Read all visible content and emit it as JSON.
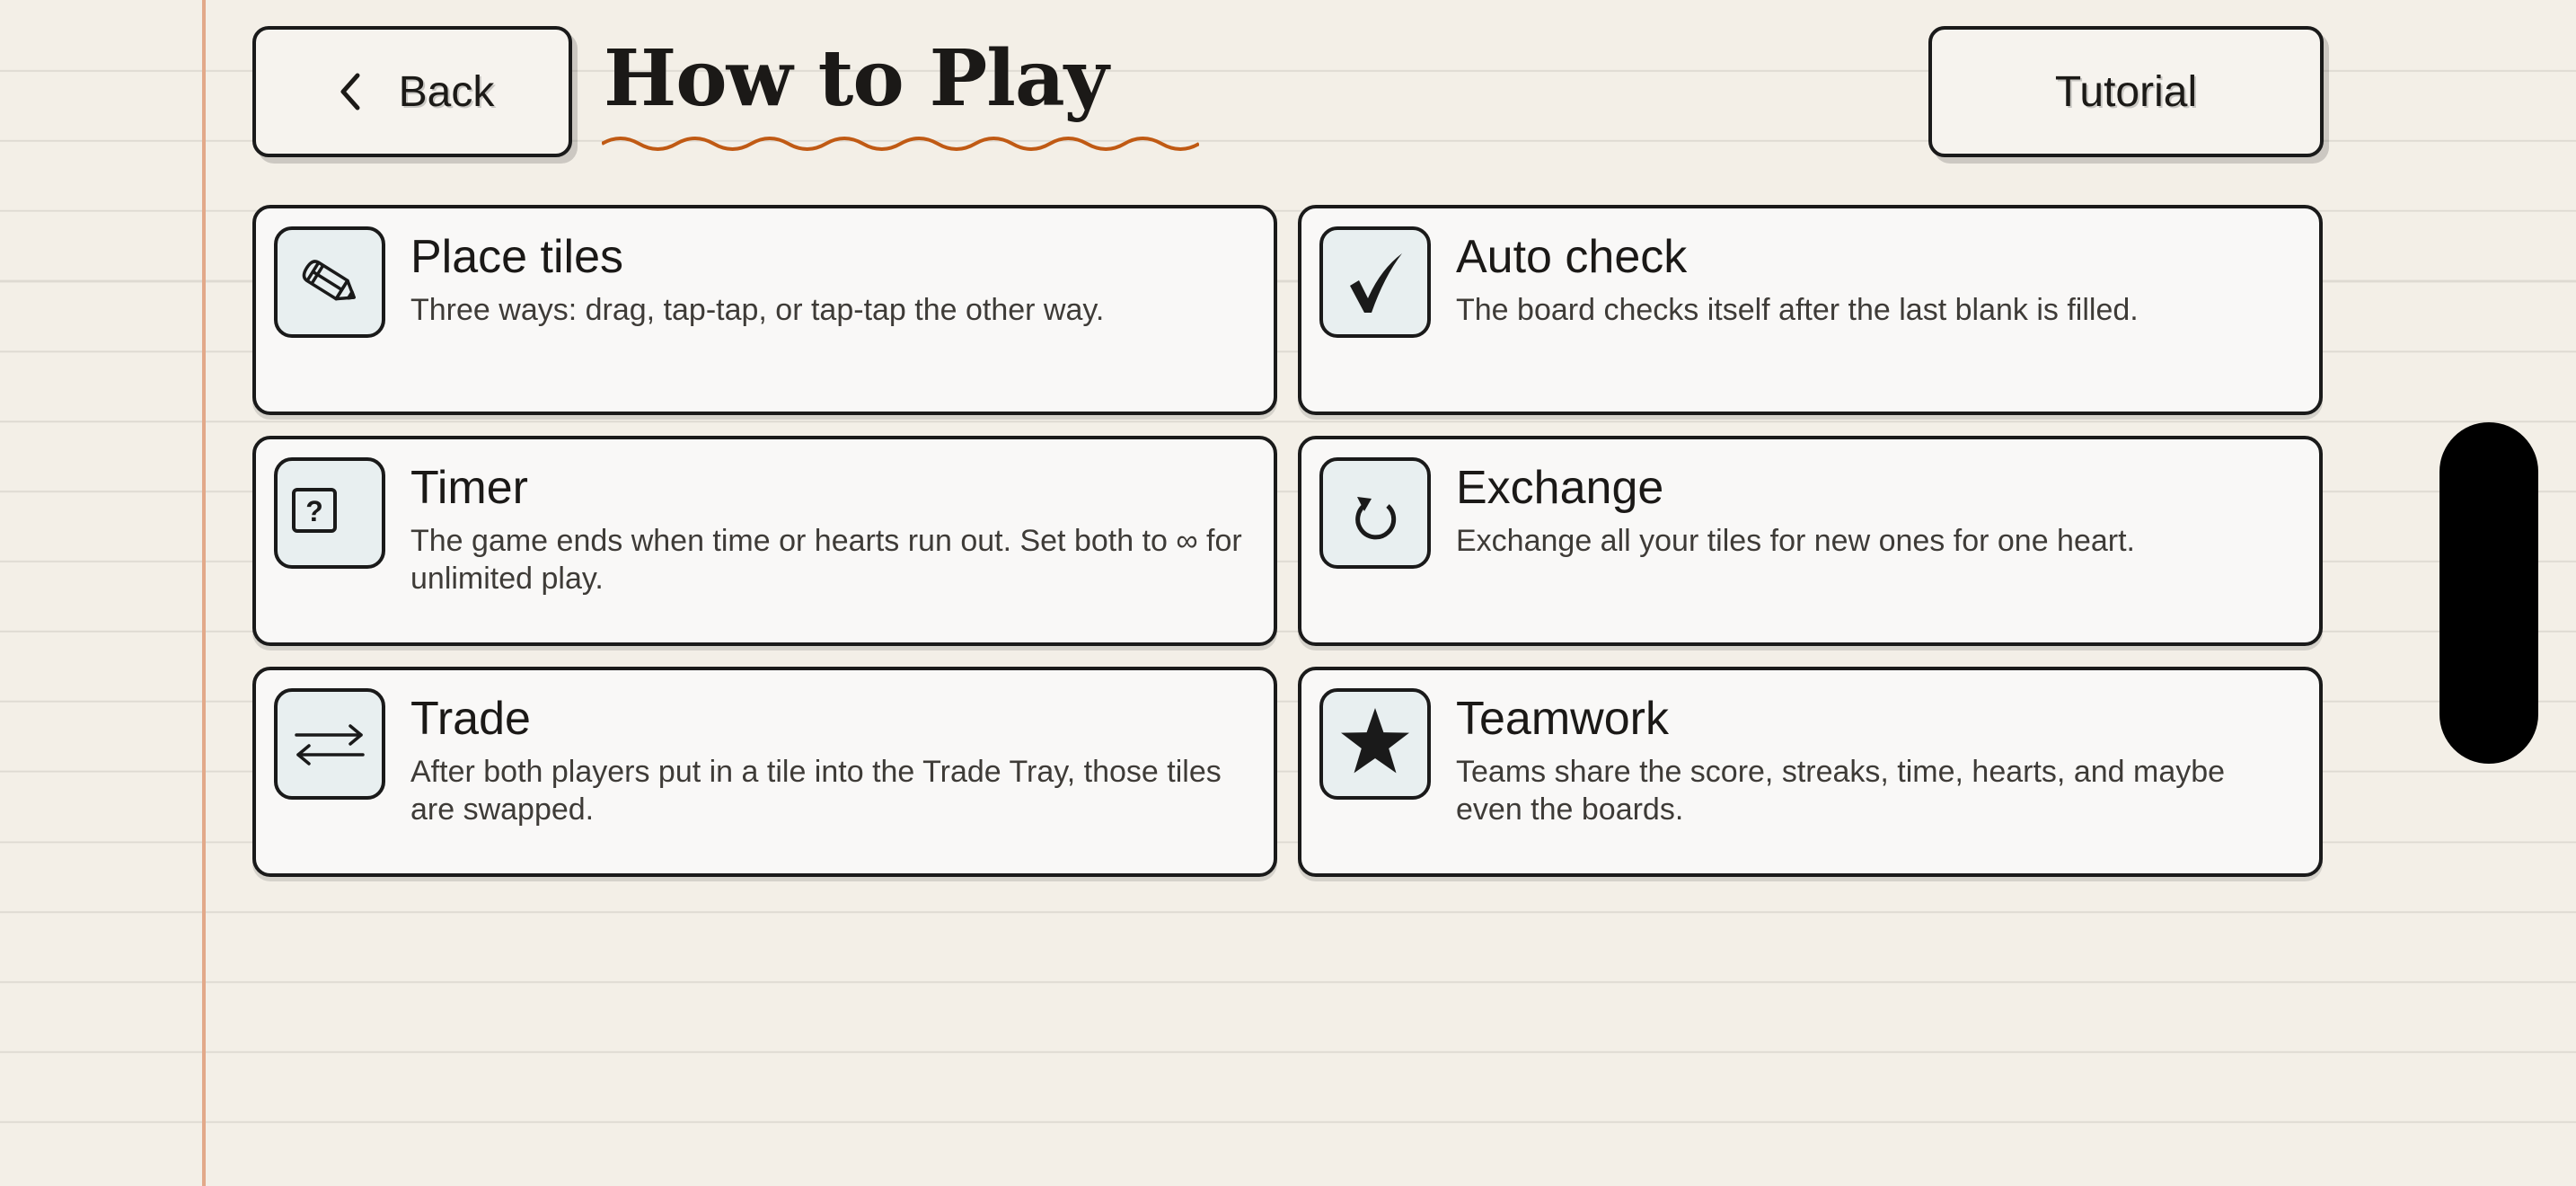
{
  "header": {
    "back_label": "Back",
    "title": "How to Play",
    "tutorial_label": "Tutorial"
  },
  "colors": {
    "paper": "#f3efe7",
    "rule_line": "#dedad2",
    "margin_line": "#e2a98a",
    "title_underline": "#c05a14",
    "card_bg": "#f9f8f7",
    "icon_bg": "#e8eff0",
    "ink": "#1a1a1a"
  },
  "cards": [
    {
      "icon": "pencil-icon",
      "title": "Place tiles",
      "desc": "Three ways: drag, tap-tap, or tap-tap the other way."
    },
    {
      "icon": "checkmark-icon",
      "title": "Auto check",
      "desc": "The board checks itself after the last blank is filled."
    },
    {
      "icon": "question-box-icon",
      "title": "Timer",
      "desc": "The game ends when time or hearts run out. Set both to ∞ for unlimited play."
    },
    {
      "icon": "refresh-icon",
      "title": "Exchange",
      "desc": "Exchange all your tiles for new ones for one heart."
    },
    {
      "icon": "swap-arrows-icon",
      "title": "Trade",
      "desc": "After both players put in a tile into the Trade Tray, those tiles are swapped."
    },
    {
      "icon": "star-icon",
      "title": "Teamwork",
      "desc": "Teams share the score, streaks, time, hearts, and maybe even the boards."
    }
  ]
}
